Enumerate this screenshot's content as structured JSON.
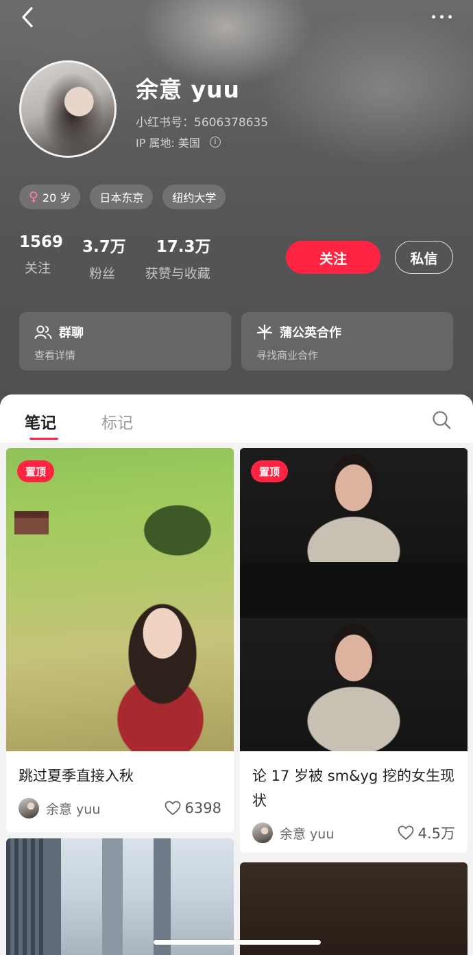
{
  "nav": {
    "back_icon": "chevron-left-icon",
    "more_icon": "more-horizontal-icon"
  },
  "profile": {
    "name": "余意 yuu",
    "redid": "小红书号：5606378635",
    "ip_location": "IP 属地: 美国",
    "info_icon_glyph": "i",
    "tags": [
      {
        "icon": "female-icon",
        "glyph": "♀",
        "label": "20 岁"
      },
      {
        "label": "日本东京"
      },
      {
        "label": "纽约大学"
      }
    ],
    "stats": [
      {
        "value": "1569",
        "label": "关注"
      },
      {
        "value": "3.7万",
        "label": "粉丝"
      },
      {
        "value": "17.3万",
        "label": "获赞与收藏"
      }
    ],
    "follow_label": "关注",
    "message_label": "私信",
    "group_chat": {
      "title": "群聊",
      "subtitle": "查看详情",
      "icon": "group-icon"
    },
    "pugongying": {
      "title": "蒲公英合作",
      "subtitle": "寻找商业合作",
      "icon": "dandelion-icon"
    }
  },
  "tabs": [
    {
      "label": "笔记",
      "active": true
    },
    {
      "label": "标记",
      "active": false
    }
  ],
  "search_icon": "search-icon",
  "notes": [
    {
      "pin_label": "置顶",
      "title": "跳过夏季直接入秋",
      "author": "余意 yuu",
      "likes": "6398"
    },
    {
      "pin_label": "置顶",
      "title": "论 17 岁被 sm&yg 挖的女生现状",
      "author": "余意 yuu",
      "likes": "4.5万"
    }
  ],
  "colors": {
    "accent": "#ff2442",
    "header_bg": "#555555",
    "panel_bg": "#f3f3f3"
  }
}
